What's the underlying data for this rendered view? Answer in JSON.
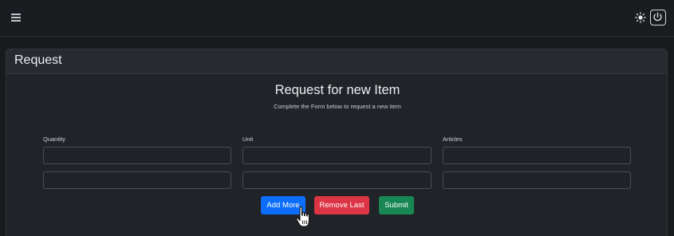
{
  "topbar": {
    "menu_icon": "hamburger-icon",
    "theme_icon": "sun-icon",
    "power_icon": "power-icon"
  },
  "card": {
    "title": "Request"
  },
  "form": {
    "title": "Request for new Item",
    "subtitle": "Complete the Form below to request a new item",
    "columns": {
      "quantity": "Quantity",
      "unit": "Unit",
      "articles": "Articles"
    },
    "rows": [
      {
        "quantity": "",
        "unit": "",
        "articles": ""
      },
      {
        "quantity": "",
        "unit": "",
        "articles": ""
      }
    ],
    "buttons": {
      "add_more": "Add More",
      "remove_last": "Remove Last",
      "submit": "Submit"
    }
  },
  "colors": {
    "background": "#181a1e",
    "card": "#202327",
    "primary": "#0d6efd",
    "danger": "#dc3545",
    "success": "#198754"
  }
}
